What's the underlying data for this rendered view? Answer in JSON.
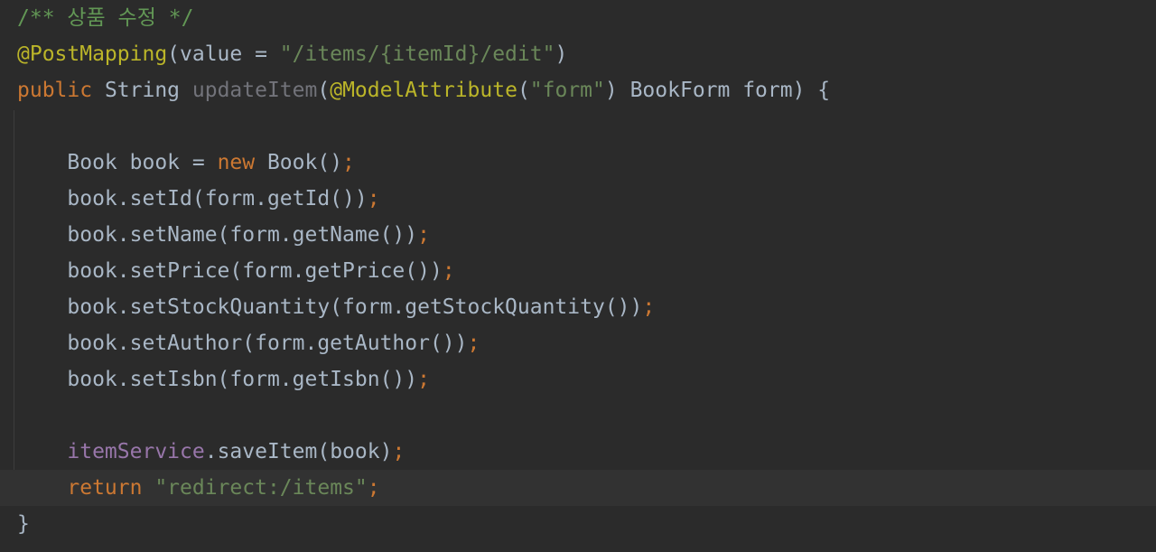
{
  "editor": {
    "lines": [
      {
        "tokens": [
          {
            "text": "/** 상품 수정 */",
            "kind": "comment"
          }
        ]
      },
      {
        "tokens": [
          {
            "text": "@PostMapping",
            "kind": "annotation"
          },
          {
            "text": "(value = ",
            "kind": "plain"
          },
          {
            "text": "\"/items/{itemId}/edit\"",
            "kind": "string"
          },
          {
            "text": ")",
            "kind": "plain"
          }
        ]
      },
      {
        "tokens": [
          {
            "text": "public ",
            "kind": "keyword"
          },
          {
            "text": "String ",
            "kind": "plain"
          },
          {
            "text": "updateItem",
            "kind": "unused"
          },
          {
            "text": "(",
            "kind": "plain"
          },
          {
            "text": "@ModelAttribute",
            "kind": "annotation"
          },
          {
            "text": "(",
            "kind": "plain"
          },
          {
            "text": "\"form\"",
            "kind": "string"
          },
          {
            "text": ") BookForm form) {",
            "kind": "plain"
          }
        ]
      },
      {
        "tokens": []
      },
      {
        "tokens": [
          {
            "text": "    Book book = ",
            "kind": "plain"
          },
          {
            "text": "new ",
            "kind": "keyword"
          },
          {
            "text": "Book()",
            "kind": "plain"
          },
          {
            "text": ";",
            "kind": "semicolon"
          }
        ]
      },
      {
        "tokens": [
          {
            "text": "    book.setId(form.getId())",
            "kind": "plain"
          },
          {
            "text": ";",
            "kind": "semicolon"
          }
        ]
      },
      {
        "tokens": [
          {
            "text": "    book.setName(form.getName())",
            "kind": "plain"
          },
          {
            "text": ";",
            "kind": "semicolon"
          }
        ]
      },
      {
        "tokens": [
          {
            "text": "    book.setPrice(form.getPrice())",
            "kind": "plain"
          },
          {
            "text": ";",
            "kind": "semicolon"
          }
        ]
      },
      {
        "tokens": [
          {
            "text": "    book.setStockQuantity(form.getStockQuantity())",
            "kind": "plain"
          },
          {
            "text": ";",
            "kind": "semicolon"
          }
        ]
      },
      {
        "tokens": [
          {
            "text": "    book.setAuthor(form.getAuthor())",
            "kind": "plain"
          },
          {
            "text": ";",
            "kind": "semicolon"
          }
        ]
      },
      {
        "tokens": [
          {
            "text": "    book.setIsbn(form.getIsbn())",
            "kind": "plain"
          },
          {
            "text": ";",
            "kind": "semicolon"
          }
        ]
      },
      {
        "tokens": []
      },
      {
        "tokens": [
          {
            "text": "    ",
            "kind": "plain"
          },
          {
            "text": "itemService",
            "kind": "field"
          },
          {
            "text": ".saveItem(book)",
            "kind": "plain"
          },
          {
            "text": ";",
            "kind": "semicolon"
          }
        ]
      },
      {
        "current": true,
        "tokens": [
          {
            "text": "    ",
            "kind": "plain"
          },
          {
            "text": "return ",
            "kind": "keyword"
          },
          {
            "text": "\"redirect:/items\"",
            "kind": "string"
          },
          {
            "text": ";",
            "kind": "semicolon"
          }
        ]
      },
      {
        "tokens": [
          {
            "text": "}",
            "kind": "plain"
          }
        ]
      }
    ]
  }
}
